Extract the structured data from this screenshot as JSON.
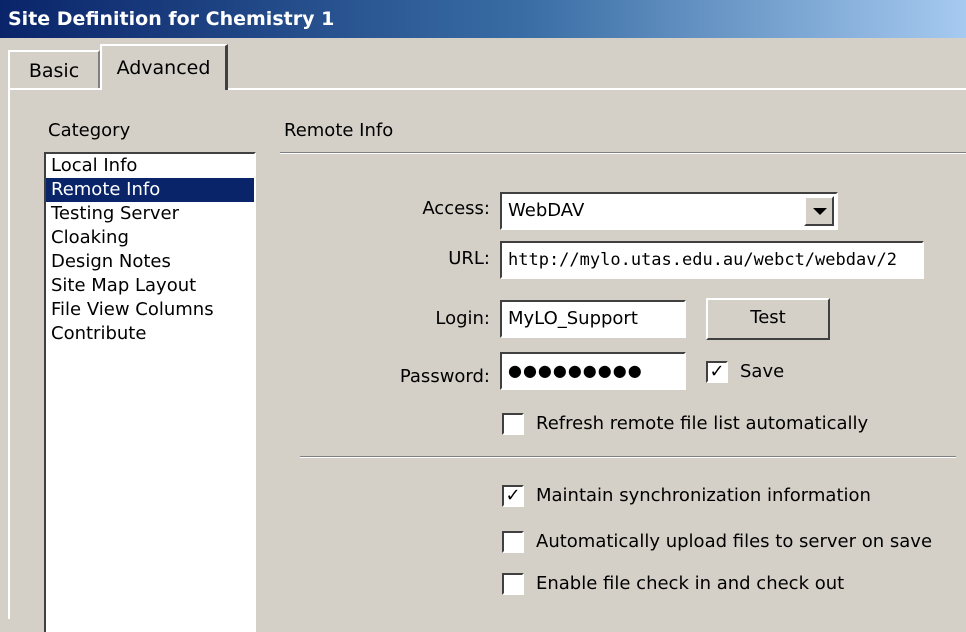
{
  "window": {
    "title": "Site Definition for Chemistry 1"
  },
  "tabs": [
    {
      "label": "Basic",
      "active": false
    },
    {
      "label": "Advanced",
      "active": true
    }
  ],
  "category": {
    "heading": "Category",
    "items": [
      "Local Info",
      "Remote Info",
      "Testing Server",
      "Cloaking",
      "Design Notes",
      "Site Map Layout",
      "File View Columns",
      "Contribute"
    ],
    "selected": "Remote Info"
  },
  "section": {
    "title": "Remote Info"
  },
  "form": {
    "access": {
      "label": "Access:",
      "value": "WebDAV"
    },
    "url": {
      "label": "URL:",
      "value": "http://mylo.utas.edu.au/webct/webdav/2"
    },
    "login": {
      "label": "Login:",
      "value": "MyLO_Support"
    },
    "password": {
      "label": "Password:",
      "value": "●●●●●●●●●"
    },
    "test_button": "Test",
    "save": {
      "label": "Save",
      "checked": true
    },
    "refresh": {
      "label": "Refresh remote file list automatically",
      "checked": false
    },
    "maintain_sync": {
      "label": "Maintain synchronization information",
      "checked": true
    },
    "auto_upload": {
      "label": "Automatically upload files to server on save",
      "checked": false
    },
    "check_in_out": {
      "label": "Enable file check in and check out",
      "checked": false
    }
  }
}
